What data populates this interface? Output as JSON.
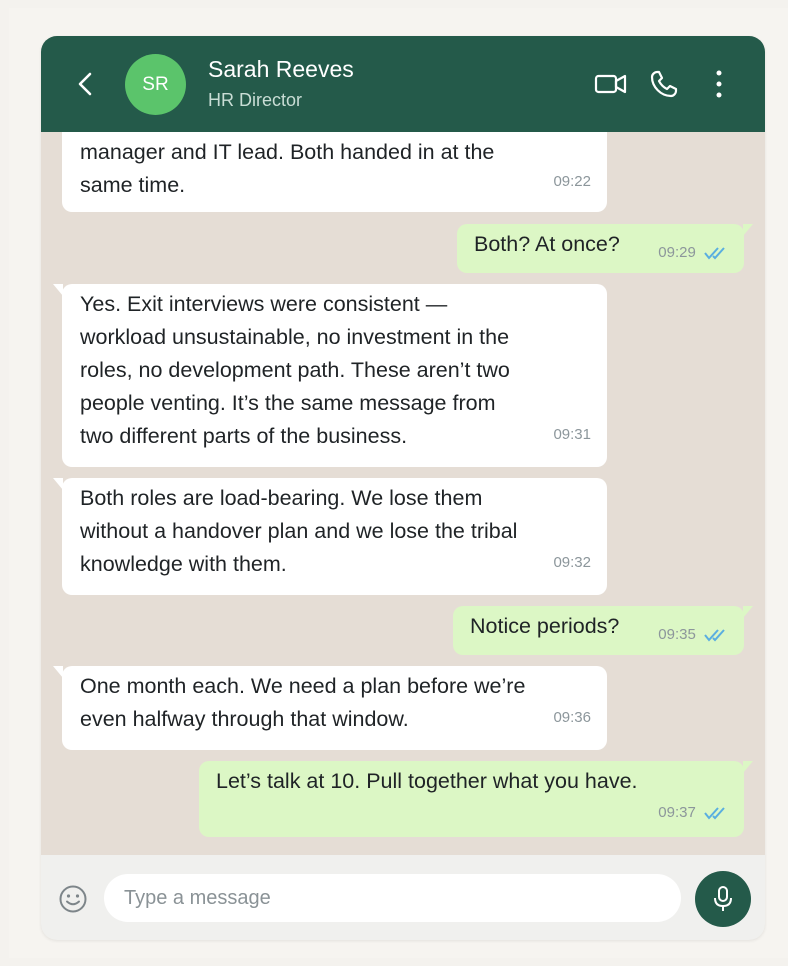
{
  "header": {
    "contact_name": "Sarah Reeves",
    "contact_role": "HR Director",
    "avatar_initials": "SR",
    "icons": [
      "chevron-left-icon",
      "video-camera-icon",
      "phone-icon",
      "more-vertical-icon"
    ]
  },
  "messages": [
    {
      "dir": "in",
      "lines": [
        "manager and IT lead. Both handed in at the",
        "same time."
      ],
      "time": "09:22"
    },
    {
      "dir": "out",
      "lines": [
        "Both? At once?"
      ],
      "time": "09:29",
      "read": true
    },
    {
      "dir": "in",
      "lines": [
        "Yes. Exit interviews were consistent —",
        "workload unsustainable, no investment in the",
        "roles, no development path. These aren’t two",
        "people venting. It’s the same message from",
        "two different parts of the business."
      ],
      "time": "09:31"
    },
    {
      "dir": "in",
      "lines": [
        "Both roles are load-bearing. We lose them",
        "without a handover plan and we lose the tribal",
        "knowledge with them."
      ],
      "time": "09:32"
    },
    {
      "dir": "out",
      "lines": [
        "Notice periods?"
      ],
      "time": "09:35",
      "read": true
    },
    {
      "dir": "in",
      "lines": [
        "One month each. We need a plan before we’re",
        "even halfway through that window."
      ],
      "time": "09:36"
    },
    {
      "dir": "out",
      "lines": [
        "Let’s talk at 10. Pull together what you have."
      ],
      "time": "09:37",
      "read": true
    }
  ],
  "composer": {
    "placeholder": "Type a message",
    "icons": [
      "emoji-icon",
      "microphone-icon"
    ]
  },
  "colors": {
    "header": "#245a4a",
    "avatar": "#5bc46b",
    "chat_background": "#e5ddd5",
    "incoming_bubble": "#ffffff",
    "outgoing_bubble": "#dcf7c5",
    "read_ticks": "#5aaee0"
  }
}
